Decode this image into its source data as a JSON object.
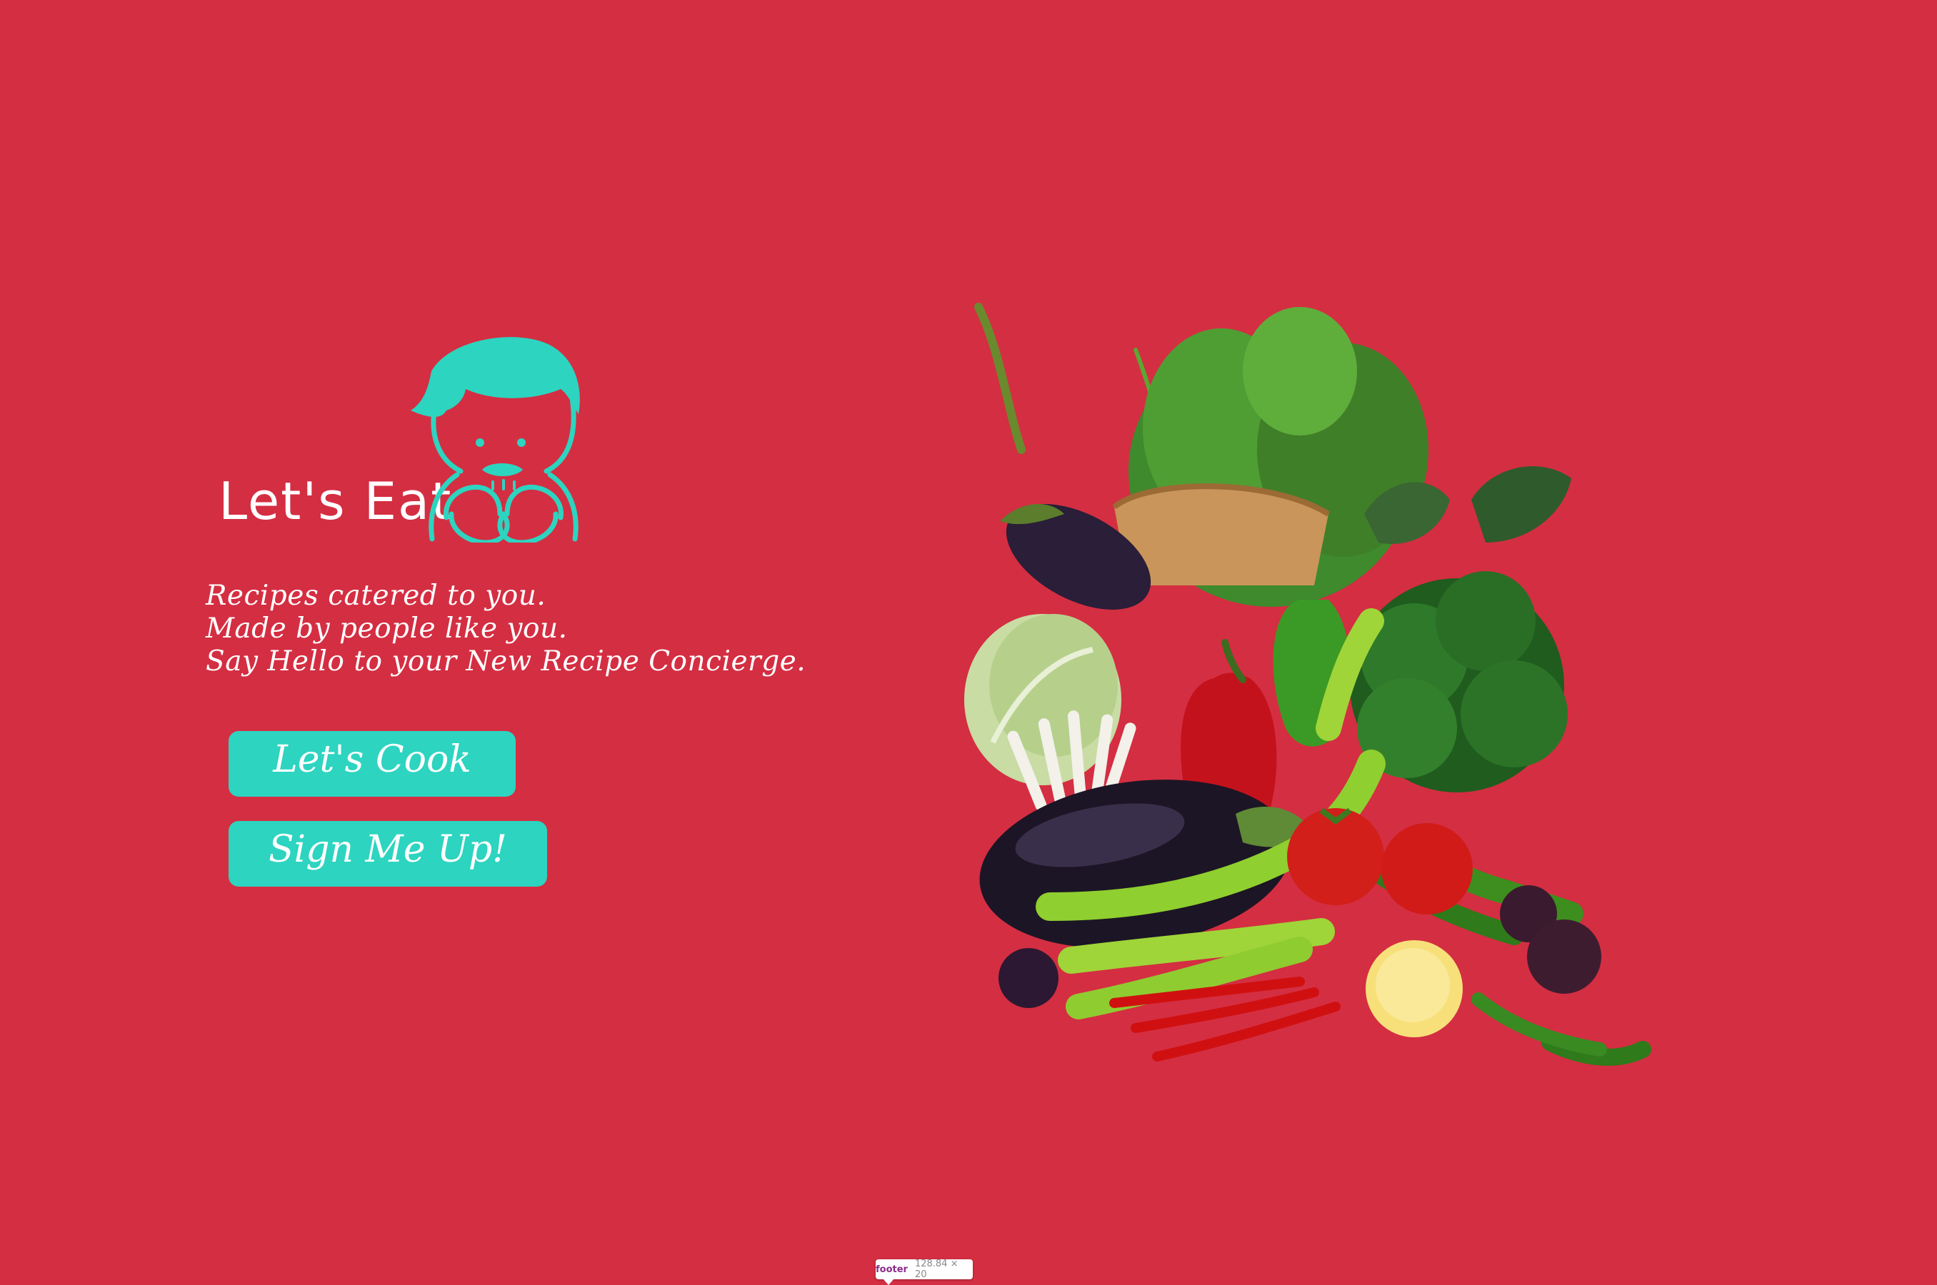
{
  "brand": {
    "name": "Let's Eat"
  },
  "tagline": {
    "line1": "Recipes catered to you.",
    "line2": "Made by people like you.",
    "line3": "Say Hello to your New Recipe Concierge."
  },
  "buttons": {
    "cook": "Let's Cook",
    "signup": "Sign Me Up!"
  },
  "devtools_tooltip": {
    "tag": "footer",
    "dimensions": "128.84 × 20"
  },
  "colors": {
    "background": "#d42e42",
    "accent": "#2dd4c0",
    "text": "#ffffff"
  },
  "icons": {
    "mascot": "boy-eating-icon"
  },
  "image": {
    "subject": "vegetables"
  }
}
